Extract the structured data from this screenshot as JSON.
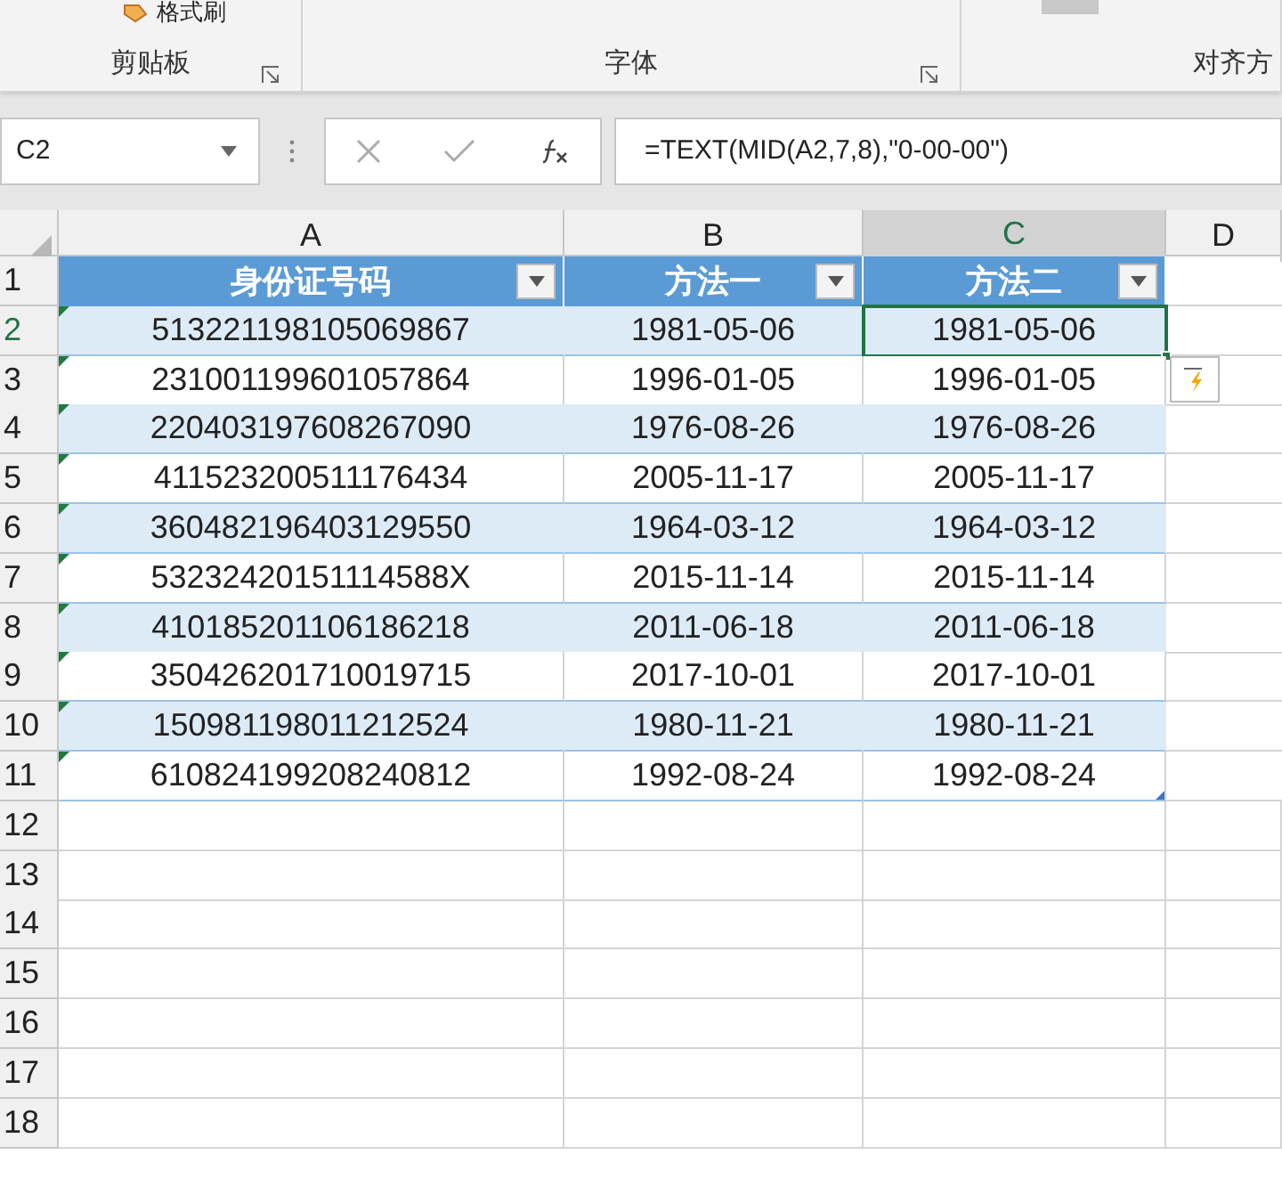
{
  "ribbon": {
    "top_button": "格式刷",
    "groups": [
      {
        "label": "剪贴板",
        "launcher": true
      },
      {
        "label": "字体",
        "launcher": true
      },
      {
        "label": "对齐方",
        "launcher": false
      }
    ]
  },
  "formula_bar": {
    "name_box": "C2",
    "formula": "=TEXT(MID(A2,7,8),\"0-00-00\")"
  },
  "column_headers": [
    {
      "label": "A",
      "selected": false
    },
    {
      "label": "B",
      "selected": false
    },
    {
      "label": "C",
      "selected": true
    },
    {
      "label": "D",
      "selected": false
    }
  ],
  "row_headers": [
    {
      "label": "1",
      "selected": false
    },
    {
      "label": "2",
      "selected": true
    },
    {
      "label": "3",
      "selected": false
    },
    {
      "label": "4",
      "selected": false
    },
    {
      "label": "5",
      "selected": false
    },
    {
      "label": "6",
      "selected": false
    },
    {
      "label": "7",
      "selected": false
    },
    {
      "label": "8",
      "selected": false
    },
    {
      "label": "9",
      "selected": false
    },
    {
      "label": "10",
      "selected": false
    },
    {
      "label": "11",
      "selected": false
    },
    {
      "label": "12",
      "selected": false
    },
    {
      "label": "13",
      "selected": false
    },
    {
      "label": "14",
      "selected": false
    },
    {
      "label": "15",
      "selected": false
    },
    {
      "label": "16",
      "selected": false
    },
    {
      "label": "17",
      "selected": false
    },
    {
      "label": "18",
      "selected": false
    }
  ],
  "table": {
    "columns": [
      "身份证号码",
      "方法一",
      "方法二"
    ],
    "rows": [
      {
        "banded": true,
        "number_as_text": true,
        "cells": [
          {
            "text": "513221198105069867",
            "selected": false
          },
          {
            "text": "1981-05-06",
            "selected": false
          },
          {
            "text": "1981-05-06",
            "selected": true
          }
        ]
      },
      {
        "banded": false,
        "number_as_text": true,
        "cells": [
          {
            "text": "231001199601057864",
            "selected": false
          },
          {
            "text": "1996-01-05",
            "selected": false
          },
          {
            "text": "1996-01-05",
            "selected": false
          }
        ]
      },
      {
        "banded": true,
        "number_as_text": true,
        "cells": [
          {
            "text": "220403197608267090",
            "selected": false
          },
          {
            "text": "1976-08-26",
            "selected": false
          },
          {
            "text": "1976-08-26",
            "selected": false
          }
        ]
      },
      {
        "banded": false,
        "number_as_text": true,
        "cells": [
          {
            "text": "411523200511176434",
            "selected": false
          },
          {
            "text": "2005-11-17",
            "selected": false
          },
          {
            "text": "2005-11-17",
            "selected": false
          }
        ]
      },
      {
        "banded": true,
        "number_as_text": true,
        "cells": [
          {
            "text": "360482196403129550",
            "selected": false
          },
          {
            "text": "1964-03-12",
            "selected": false
          },
          {
            "text": "1964-03-12",
            "selected": false
          }
        ]
      },
      {
        "banded": false,
        "number_as_text": true,
        "cells": [
          {
            "text": "53232420151114588X",
            "selected": false
          },
          {
            "text": "2015-11-14",
            "selected": false
          },
          {
            "text": "2015-11-14",
            "selected": false
          }
        ]
      },
      {
        "banded": true,
        "number_as_text": true,
        "cells": [
          {
            "text": "410185201106186218",
            "selected": false
          },
          {
            "text": "2011-06-18",
            "selected": false
          },
          {
            "text": "2011-06-18",
            "selected": false
          }
        ]
      },
      {
        "banded": false,
        "number_as_text": true,
        "cells": [
          {
            "text": "350426201710019715",
            "selected": false
          },
          {
            "text": "2017-10-01",
            "selected": false
          },
          {
            "text": "2017-10-01",
            "selected": false
          }
        ]
      },
      {
        "banded": true,
        "number_as_text": true,
        "cells": [
          {
            "text": "150981198011212524",
            "selected": false
          },
          {
            "text": "1980-11-21",
            "selected": false
          },
          {
            "text": "1980-11-21",
            "selected": false
          }
        ]
      },
      {
        "banded": false,
        "number_as_text": true,
        "cells": [
          {
            "text": "610824199208240812",
            "selected": false
          },
          {
            "text": "1992-08-24",
            "selected": false
          },
          {
            "text": "1992-08-24",
            "selected": false
          }
        ]
      }
    ]
  }
}
